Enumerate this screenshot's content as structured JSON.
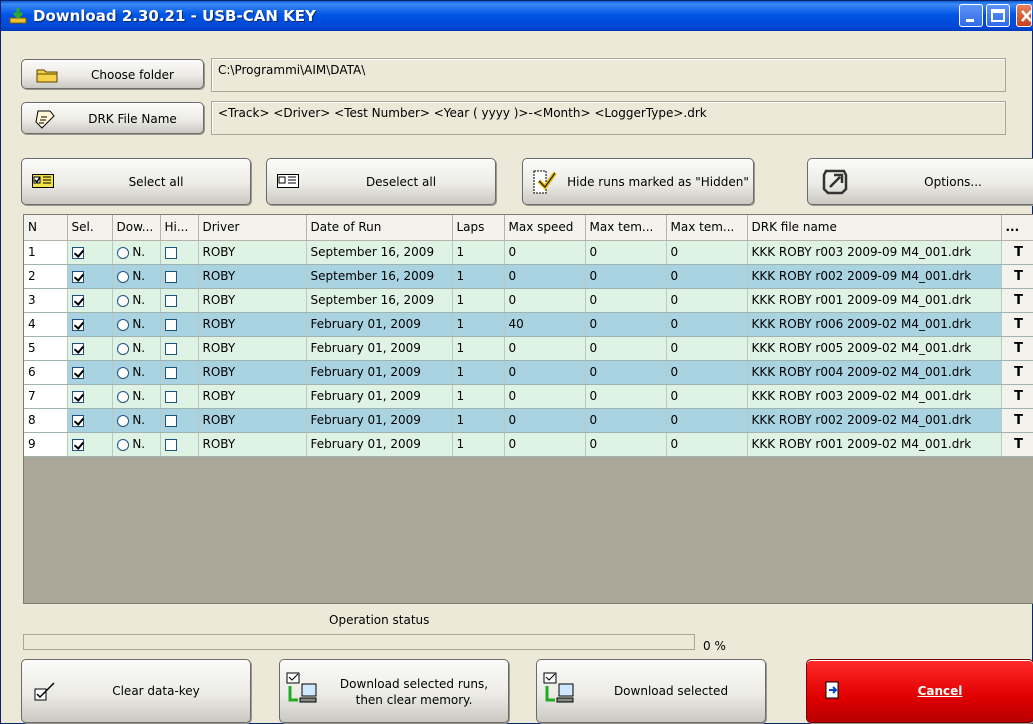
{
  "window": {
    "title": "Download 2.30.21 - USB-CAN KEY",
    "icon": "download-app-icon"
  },
  "folder": {
    "button_label": "Choose folder",
    "path": "C:\\Programmi\\AIM\\DATA\\"
  },
  "drk": {
    "button_label": "DRK File Name",
    "pattern": "<Track> <Driver> <Test Number> <Year ( yyyy )>-<Month> <LoggerType>.drk"
  },
  "toolbar": {
    "select_all": "Select all",
    "deselect_all": "Deselect all",
    "hide_runs": "Hide runs marked as \"Hidden\"",
    "options": "Options..."
  },
  "table": {
    "columns": [
      "N",
      "Sel.",
      "Dow...",
      "Hi...",
      "Driver",
      "Date of Run",
      "Laps",
      "Max speed",
      "Max tem...",
      "Max tem...",
      "DRK file name",
      "..."
    ],
    "rows": [
      {
        "n": "1",
        "sel": true,
        "dl_letter": "N.",
        "hidden": false,
        "driver": "ROBY",
        "date": "September 16, 2009",
        "laps": "1",
        "max_speed": "0",
        "max_temp1": "0",
        "max_temp2": "0",
        "file": "KKK ROBY r003 2009-09 M4_001.drk",
        "t": "T"
      },
      {
        "n": "2",
        "sel": true,
        "dl_letter": "N.",
        "hidden": false,
        "driver": "ROBY",
        "date": "September 16, 2009",
        "laps": "1",
        "max_speed": "0",
        "max_temp1": "0",
        "max_temp2": "0",
        "file": "KKK ROBY r002 2009-09 M4_001.drk",
        "t": "T"
      },
      {
        "n": "3",
        "sel": true,
        "dl_letter": "N.",
        "hidden": false,
        "driver": "ROBY",
        "date": "September 16, 2009",
        "laps": "1",
        "max_speed": "0",
        "max_temp1": "0",
        "max_temp2": "0",
        "file": "KKK ROBY r001 2009-09 M4_001.drk",
        "t": "T"
      },
      {
        "n": "4",
        "sel": true,
        "dl_letter": "N.",
        "hidden": false,
        "driver": "ROBY",
        "date": "February 01, 2009",
        "laps": "1",
        "max_speed": "40",
        "max_temp1": "0",
        "max_temp2": "0",
        "file": "KKK ROBY r006 2009-02 M4_001.drk",
        "t": "T"
      },
      {
        "n": "5",
        "sel": true,
        "dl_letter": "N.",
        "hidden": false,
        "driver": "ROBY",
        "date": "February 01, 2009",
        "laps": "1",
        "max_speed": "0",
        "max_temp1": "0",
        "max_temp2": "0",
        "file": "KKK ROBY r005 2009-02 M4_001.drk",
        "t": "T"
      },
      {
        "n": "6",
        "sel": true,
        "dl_letter": "N.",
        "hidden": false,
        "driver": "ROBY",
        "date": "February 01, 2009",
        "laps": "1",
        "max_speed": "0",
        "max_temp1": "0",
        "max_temp2": "0",
        "file": "KKK ROBY r004 2009-02 M4_001.drk",
        "t": "T"
      },
      {
        "n": "7",
        "sel": true,
        "dl_letter": "N.",
        "hidden": false,
        "driver": "ROBY",
        "date": "February 01, 2009",
        "laps": "1",
        "max_speed": "0",
        "max_temp1": "0",
        "max_temp2": "0",
        "file": "KKK ROBY r003 2009-02 M4_001.drk",
        "t": "T"
      },
      {
        "n": "8",
        "sel": true,
        "dl_letter": "N.",
        "hidden": false,
        "driver": "ROBY",
        "date": "February 01, 2009",
        "laps": "1",
        "max_speed": "0",
        "max_temp1": "0",
        "max_temp2": "0",
        "file": "KKK ROBY r002 2009-02 M4_001.drk",
        "t": "T"
      },
      {
        "n": "9",
        "sel": true,
        "dl_letter": "N.",
        "hidden": false,
        "driver": "ROBY",
        "date": "February 01, 2009",
        "laps": "1",
        "max_speed": "0",
        "max_temp1": "0",
        "max_temp2": "0",
        "file": "KKK ROBY r001 2009-02 M4_001.drk",
        "t": "T"
      }
    ]
  },
  "status": {
    "label": "Operation status",
    "progress_percent": 0,
    "progress_text": "0 %"
  },
  "actions": {
    "clear_key": "Clear data-key",
    "download_clear_line1": "Download selected runs,",
    "download_clear_line2": "then clear memory.",
    "download_selected": "Download selected",
    "cancel": "Cancel"
  },
  "colors": {
    "row_odd": "#dff3e4",
    "row_even": "#a9d3e0",
    "cancel_red": "#e00000",
    "titlebar_blue": "#0055e5"
  }
}
